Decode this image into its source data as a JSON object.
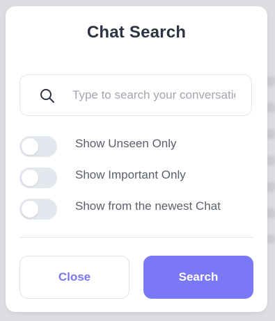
{
  "dialog": {
    "title": "Chat Search"
  },
  "search": {
    "placeholder": "Type to search your conversations",
    "value": "",
    "icon": "search-icon"
  },
  "options": [
    {
      "label": "Show Unseen Only",
      "enabled": false
    },
    {
      "label": "Show Important Only",
      "enabled": false
    },
    {
      "label": "Show from the newest Chat",
      "enabled": false
    }
  ],
  "actions": {
    "close_label": "Close",
    "search_label": "Search"
  },
  "colors": {
    "accent": "#7a78f4",
    "accent_text": "#7b78ee",
    "title": "#2d3342",
    "toggle_off": "#e3e7ee"
  }
}
